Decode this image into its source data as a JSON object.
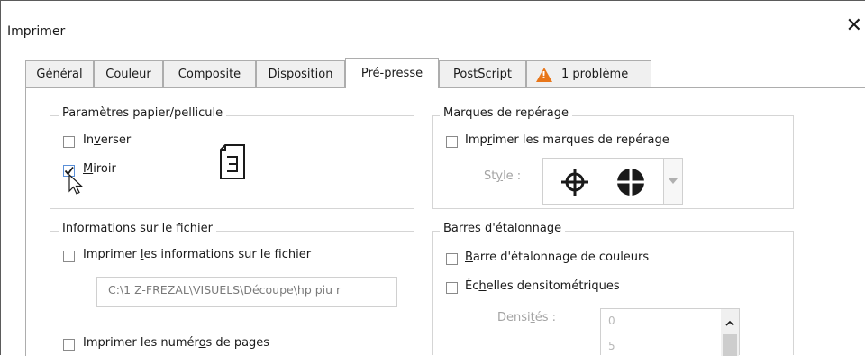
{
  "window": {
    "title": "Imprimer",
    "close_glyph": "✕"
  },
  "tabs": [
    {
      "label": "Général",
      "active": false
    },
    {
      "label": "Couleur",
      "active": false
    },
    {
      "label": "Composite",
      "active": false
    },
    {
      "label": "Disposition",
      "active": false
    },
    {
      "label": "Pré-presse",
      "active": true
    },
    {
      "label": "PostScript",
      "active": false
    },
    {
      "label": "1 problème",
      "active": false,
      "icon": "warning-icon"
    }
  ],
  "paper": {
    "title": "Paramètres papier/pellicule",
    "invert": {
      "pre": "In",
      "u": "v",
      "post": "erser",
      "checked": false
    },
    "mirror": {
      "pre": "",
      "u": "M",
      "post": "iroir",
      "checked": true
    },
    "preview_icon": "page-mirror-icon"
  },
  "registration": {
    "title": "Marques de repérage",
    "print": {
      "pre": "Imp",
      "u": "r",
      "post": "imer les marques de repérage",
      "checked": false
    },
    "style_pre": "St",
    "style_u": "y",
    "style_post": "le :",
    "style_icons": [
      "crosshair-icon",
      "quartered-circle-icon"
    ],
    "dropdown_icon": "chevron-down-icon"
  },
  "file_info": {
    "title": "Informations sur le fichier",
    "print": {
      "pre": "Imprimer ",
      "u": "l",
      "post": "es informations sur le fichier",
      "checked": false
    },
    "path": "C:\\1 Z-FREZAL\\VISUELS\\Découpe\\hp piu r",
    "pages": {
      "pre": "Imprimer les numér",
      "u": "o",
      "post": "s de pages",
      "checked": false
    }
  },
  "calibration": {
    "title": "Barres d'étalonnage",
    "color_bar": {
      "pre": "",
      "u": "B",
      "post": "arre d'étalonnage de couleurs",
      "checked": false
    },
    "densito": {
      "pre": "Éc",
      "u": "h",
      "post": "elles densitométriques",
      "checked": false
    },
    "dens_pre": "Densi",
    "dens_u": "t",
    "dens_post": "és :",
    "dens_values": [
      "0",
      "5"
    ],
    "scroll_icon": "chevron-up-icon"
  }
}
